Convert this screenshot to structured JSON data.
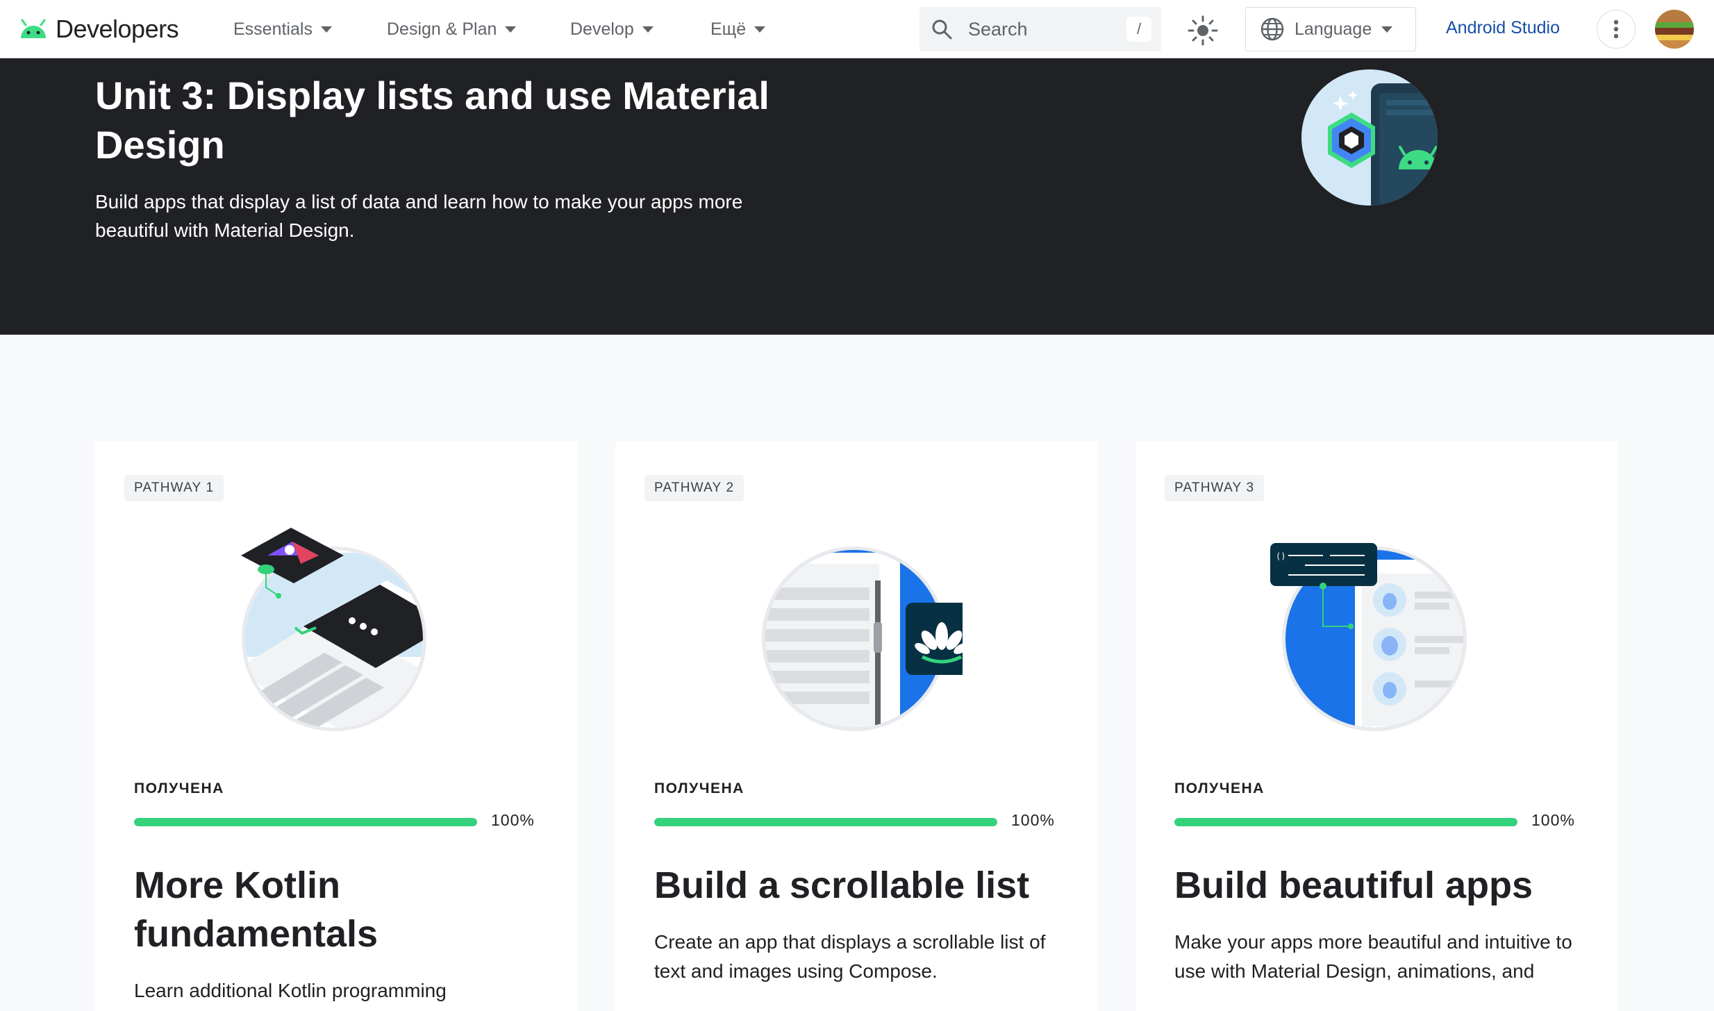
{
  "topnav": {
    "brand": "Developers",
    "menu": [
      {
        "label": "Essentials"
      },
      {
        "label": "Design & Plan"
      },
      {
        "label": "Develop"
      },
      {
        "label": "Ещё"
      }
    ],
    "search": {
      "placeholder": "Search",
      "shortcut": "/"
    },
    "language": "Language",
    "studio_link": "Android Studio",
    "icons": {
      "theme": "brightness-icon",
      "language": "globe-icon",
      "more": "more-vert-icon",
      "search": "search-icon"
    }
  },
  "hero": {
    "title": "Unit 3: Display lists and use Material Design",
    "description": "Build apps that display a list of data and learn how to make your apps more beautiful with Material Design."
  },
  "cards": [
    {
      "badge": "PATHWAY 1",
      "status": "ПОЛУЧЕНА",
      "progress": 100,
      "progress_label": "100%",
      "title": "More Kotlin fundamentals",
      "description": "Learn additional Kotlin programming"
    },
    {
      "badge": "PATHWAY 2",
      "status": "ПОЛУЧЕНА",
      "progress": 100,
      "progress_label": "100%",
      "title": "Build a scrollable list",
      "description": "Create an app that displays a scrollable list of text and images using Compose."
    },
    {
      "badge": "PATHWAY 3",
      "status": "ПОЛУЧЕНА",
      "progress": 100,
      "progress_label": "100%",
      "title": "Build beautiful apps",
      "description": "Make your apps more beautiful and intuitive to use with Material Design, animations, and"
    }
  ],
  "colors": {
    "hero_bg": "#202124",
    "progress": "#34d27b",
    "link": "#174ea6",
    "page_bg": "#f8f9fa"
  }
}
